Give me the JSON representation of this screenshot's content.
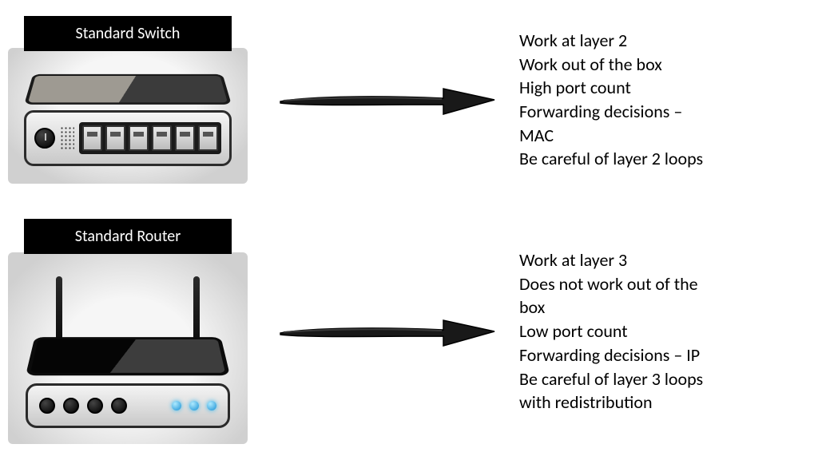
{
  "switch": {
    "label": "Standard Switch",
    "features": "Work at layer 2\nWork out of the box\nHigh port count\nForwarding decisions –\nMAC\nBe careful of layer 2 loops"
  },
  "router": {
    "label": "Standard Router",
    "features": "Work at layer 3\nDoes not work out of the\nbox\nLow port count\nForwarding decisions – IP\nBe careful of layer 3 loops\nwith redistribution"
  },
  "colors": {
    "label_bg": "#000000",
    "label_fg": "#ffffff",
    "led": "#1890d4"
  }
}
